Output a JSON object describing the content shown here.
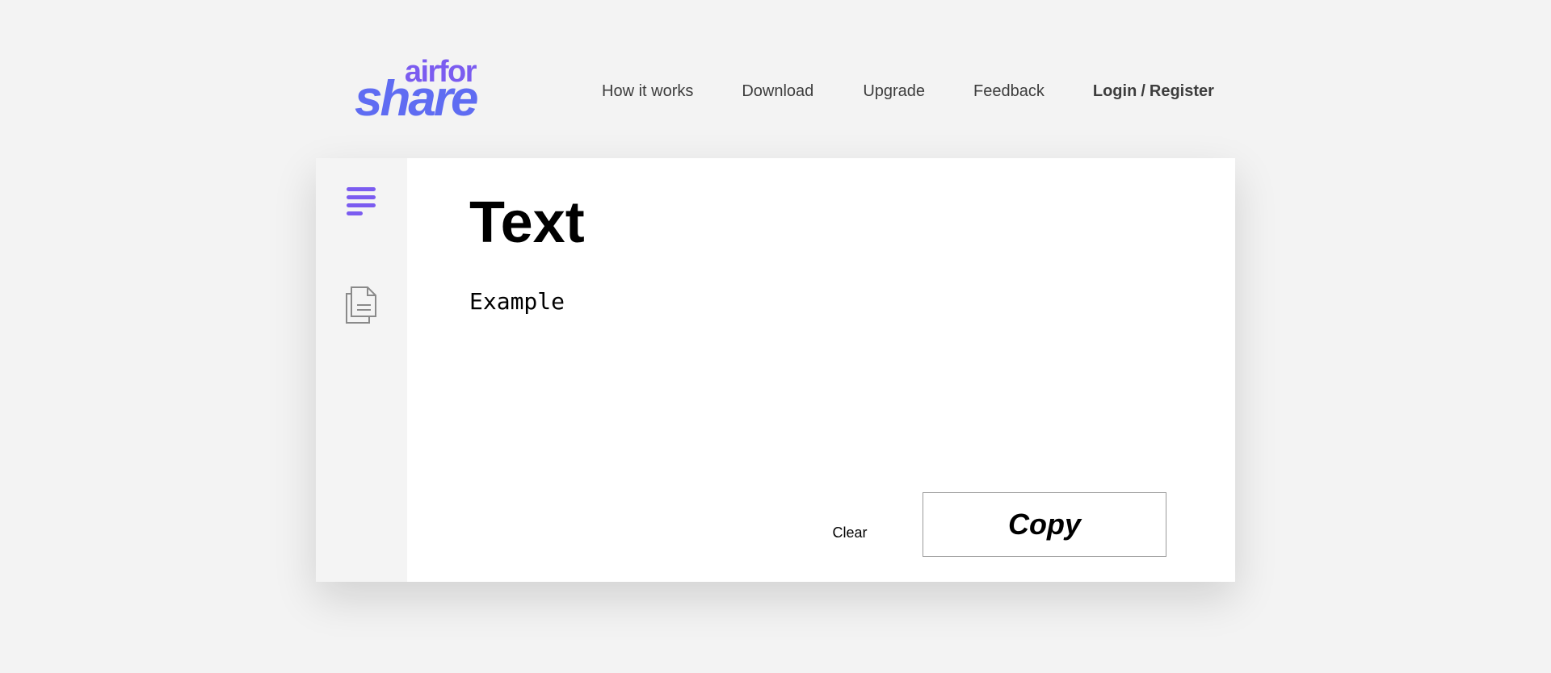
{
  "brand": {
    "logo_top": "airfor",
    "logo_bottom": "share",
    "colors": {
      "logo_top": "#7b5cf0",
      "logo_bottom": "#5f6cf2"
    }
  },
  "nav": {
    "how_it_works": "How it works",
    "download": "Download",
    "upgrade": "Upgrade",
    "feedback": "Feedback",
    "login": "Login",
    "separator": "/",
    "register": "Register"
  },
  "sidebar": {
    "items": [
      {
        "icon": "text-lines-icon",
        "active": true,
        "color": "#7b5cf0"
      },
      {
        "icon": "document-files-icon",
        "active": false,
        "color": "#8a8a8a"
      }
    ]
  },
  "main": {
    "title": "Text",
    "text_value": "Example",
    "clear_label": "Clear",
    "copy_label": "Copy"
  }
}
